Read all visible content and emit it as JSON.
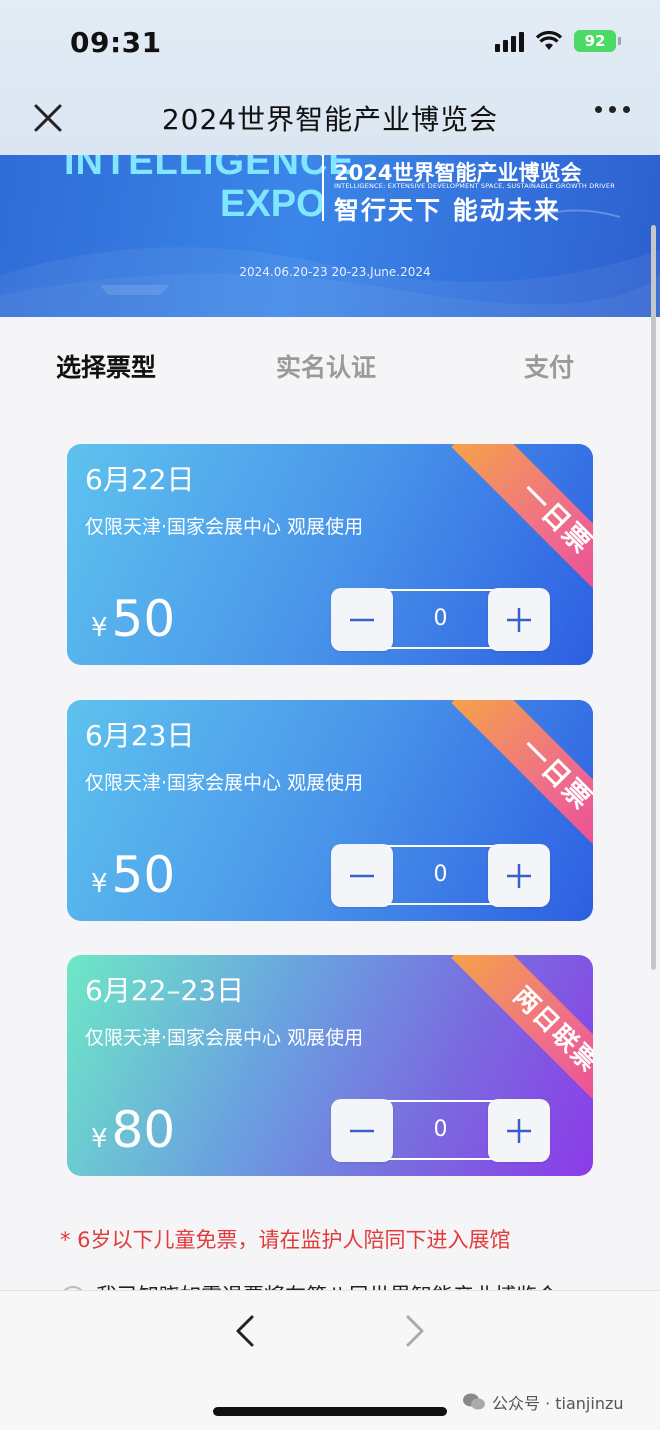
{
  "status": {
    "time": "09:31",
    "battery": "92"
  },
  "nav": {
    "title": "2024世界智能产业博览会"
  },
  "banner": {
    "en_line1": "INTELLIGENCE",
    "en_line2": "EXPO",
    "cn_title": "2024世界智能产业博览会",
    "subtitle": "INTELLIGENCE: EXTENSIVE DEVELOPMENT SPACE, SUSTAINABLE GROWTH DRIVER",
    "slogan": "智行天下 能动未来",
    "dates": "2024.06.20-23  20-23.June.2024"
  },
  "steps": [
    "选择票型",
    "实名认证",
    "支付"
  ],
  "tickets": [
    {
      "date": "6月22日",
      "venue": "仅限天津·国家会展中心 观展使用",
      "currency": "¥",
      "price": "50",
      "tag": "一日票",
      "quantity": "0"
    },
    {
      "date": "6月23日",
      "venue": "仅限天津·国家会展中心 观展使用",
      "currency": "¥",
      "price": "50",
      "tag": "一日票",
      "quantity": "0"
    },
    {
      "date": "6月22–23日",
      "venue": "仅限天津·国家会展中心 观展使用",
      "currency": "¥",
      "price": "80",
      "tag": "两日联票",
      "quantity": "0"
    }
  ],
  "note": "* 6岁以下儿童免票，请在监护人陪同下进入展馆",
  "agreement": "我已知晓如需退票将在第八届世界智能产业博览会",
  "watermark": "公众号 · tianjinzu"
}
